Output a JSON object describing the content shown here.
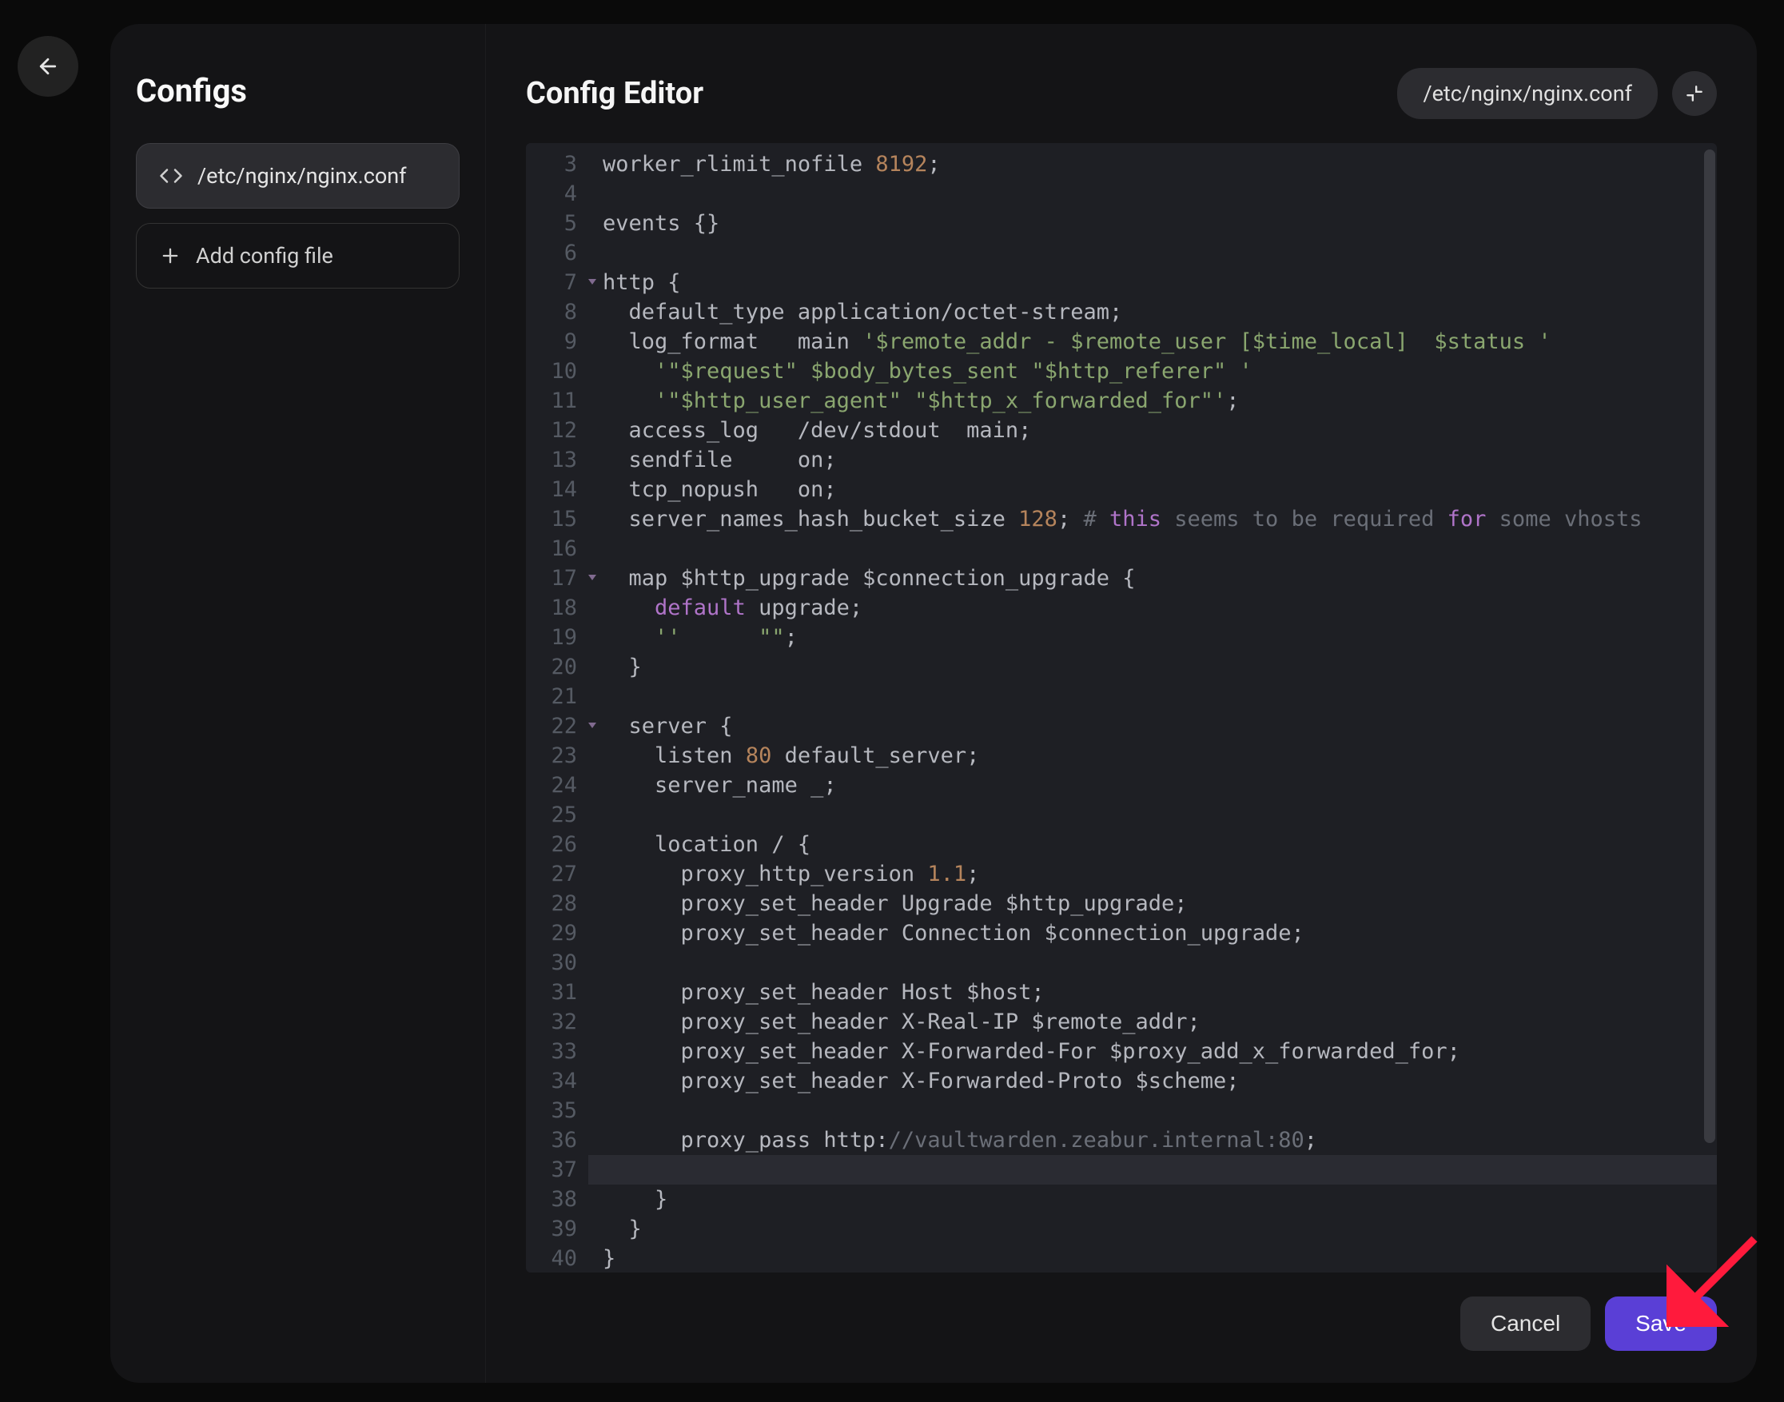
{
  "sidebar": {
    "title": "Configs",
    "items": [
      "/etc/nginx/nginx.conf"
    ],
    "add_label": "Add config file"
  },
  "editor": {
    "title": "Config Editor",
    "path": "/etc/nginx/nginx.conf",
    "first_line_number": 3,
    "fold_markers": [
      7,
      17,
      22
    ],
    "highlighted_line": 37,
    "lines": [
      [
        [
          "",
          "worker_rlimit_nofile "
        ],
        [
          "num",
          "8192"
        ],
        [
          "",
          ";"
        ]
      ],
      [
        [
          "",
          ""
        ]
      ],
      [
        [
          "",
          "events {}"
        ]
      ],
      [
        [
          "",
          ""
        ]
      ],
      [
        [
          "",
          "http {"
        ]
      ],
      [
        [
          "",
          "  default_type application/octet-stream;"
        ]
      ],
      [
        [
          "",
          "  log_format   main "
        ],
        [
          "str",
          "'$remote_addr - $remote_user [$time_local]  $status '"
        ]
      ],
      [
        [
          "",
          "    "
        ],
        [
          "str",
          "'\"$request\" $body_bytes_sent \"$http_referer\" '"
        ]
      ],
      [
        [
          "",
          "    "
        ],
        [
          "str",
          "'\"$http_user_agent\" \"$http_x_forwarded_for\"'"
        ],
        [
          "",
          ";"
        ]
      ],
      [
        [
          "",
          "  access_log   /dev/stdout  main;"
        ]
      ],
      [
        [
          "",
          "  sendfile     on;"
        ]
      ],
      [
        [
          "",
          "  tcp_nopush   on;"
        ]
      ],
      [
        [
          "",
          "  server_names_hash_bucket_size "
        ],
        [
          "num",
          "128"
        ],
        [
          "",
          "; "
        ],
        [
          "cmt",
          "# "
        ],
        [
          "kw",
          "this"
        ],
        [
          "cmt",
          " seems to be required "
        ],
        [
          "kw",
          "for"
        ],
        [
          "cmt",
          " some vhosts"
        ]
      ],
      [
        [
          "",
          ""
        ]
      ],
      [
        [
          "",
          "  map $http_upgrade $connection_upgrade {"
        ]
      ],
      [
        [
          "",
          "    "
        ],
        [
          "kw",
          "default"
        ],
        [
          "",
          " upgrade;"
        ]
      ],
      [
        [
          "",
          "    "
        ],
        [
          "str",
          "''"
        ],
        [
          "",
          "      "
        ],
        [
          "str",
          "\"\""
        ],
        [
          "",
          ";"
        ]
      ],
      [
        [
          "",
          "  }"
        ]
      ],
      [
        [
          "",
          ""
        ]
      ],
      [
        [
          "",
          "  server {"
        ]
      ],
      [
        [
          "",
          "    listen "
        ],
        [
          "num",
          "80"
        ],
        [
          "",
          " default_server;"
        ]
      ],
      [
        [
          "",
          "    server_name _;"
        ]
      ],
      [
        [
          "",
          ""
        ]
      ],
      [
        [
          "",
          "    location / {"
        ]
      ],
      [
        [
          "",
          "      proxy_http_version "
        ],
        [
          "num",
          "1.1"
        ],
        [
          "",
          ";"
        ]
      ],
      [
        [
          "",
          "      proxy_set_header Upgrade $http_upgrade;"
        ]
      ],
      [
        [
          "",
          "      proxy_set_header Connection $connection_upgrade;"
        ]
      ],
      [
        [
          "",
          ""
        ]
      ],
      [
        [
          "",
          "      proxy_set_header Host $host;"
        ]
      ],
      [
        [
          "",
          "      proxy_set_header X-Real-IP $remote_addr;"
        ]
      ],
      [
        [
          "",
          "      proxy_set_header X-Forwarded-For $proxy_add_x_forwarded_for;"
        ]
      ],
      [
        [
          "",
          "      proxy_set_header X-Forwarded-Proto $scheme;"
        ]
      ],
      [
        [
          "",
          ""
        ]
      ],
      [
        [
          "",
          "      proxy_pass http:"
        ],
        [
          "url",
          "//vaultwarden.zeabur.internal:80"
        ],
        [
          "",
          ";"
        ]
      ],
      [
        [
          "",
          ""
        ]
      ],
      [
        [
          "",
          "    }"
        ]
      ],
      [
        [
          "",
          "  }"
        ]
      ],
      [
        [
          "",
          "}"
        ]
      ],
      [
        [
          "",
          ""
        ]
      ]
    ]
  },
  "footer": {
    "cancel": "Cancel",
    "save": "Save"
  }
}
